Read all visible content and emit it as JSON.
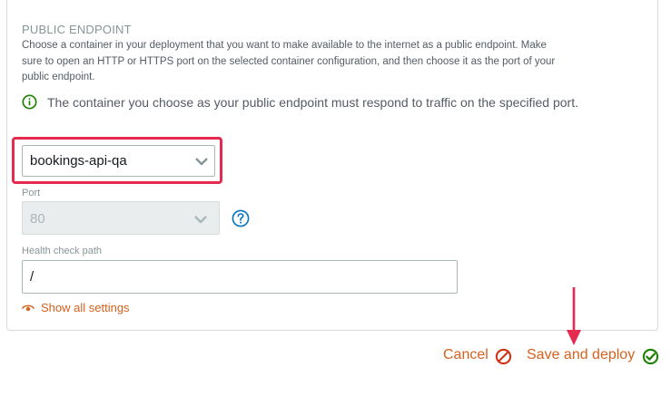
{
  "section": {
    "title": "PUBLIC ENDPOINT",
    "description": "Choose a container in your deployment that you want to make available to the internet as a public endpoint. Make sure to open an HTTP or HTTPS port on the selected container configuration, and then choose it as the port of your public endpoint."
  },
  "info": {
    "icon": "info-circle-icon",
    "text": "The container you choose as your public endpoint must respond to traffic on the specified port."
  },
  "container_select": {
    "selected": "bookings-api-qa"
  },
  "port": {
    "label": "Port",
    "selected": "80",
    "disabled": true
  },
  "health_check": {
    "label": "Health check path",
    "value": "/"
  },
  "show_settings": {
    "label": "Show all settings"
  },
  "actions": {
    "cancel_label": "Cancel",
    "deploy_label": "Save and deploy"
  },
  "colors": {
    "accent": "#d5611e",
    "highlight": "#e5294f",
    "success": "#1d8102",
    "info_icon": "#1d8102",
    "help_icon": "#0073bb"
  }
}
